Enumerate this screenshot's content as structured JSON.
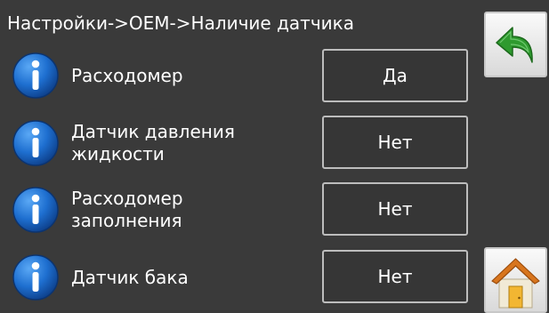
{
  "title": "Настройки->OEM->Наличие датчика",
  "rows": [
    {
      "label_lines": [
        "Расходомер"
      ],
      "value": "Да",
      "info_icon": "info-icon"
    },
    {
      "label_lines": [
        "Датчик давления",
        "жидкости"
      ],
      "value": "Нет",
      "info_icon": "info-icon"
    },
    {
      "label_lines": [
        "Расходомер",
        "заполнения"
      ],
      "value": "Нет",
      "info_icon": "info-icon"
    },
    {
      "label_lines": [
        "Датчик бака"
      ],
      "value": "Нет",
      "info_icon": "info-icon"
    }
  ],
  "nav": {
    "back_icon": "back-arrow-icon",
    "home_icon": "home-icon"
  },
  "colors": {
    "background": "#3a3a3a",
    "text": "#ffffff",
    "info_blue": "#1e6fd0",
    "back_green": "#2e9a2e",
    "home_roof": "#d8751d",
    "home_door": "#f2b632"
  }
}
